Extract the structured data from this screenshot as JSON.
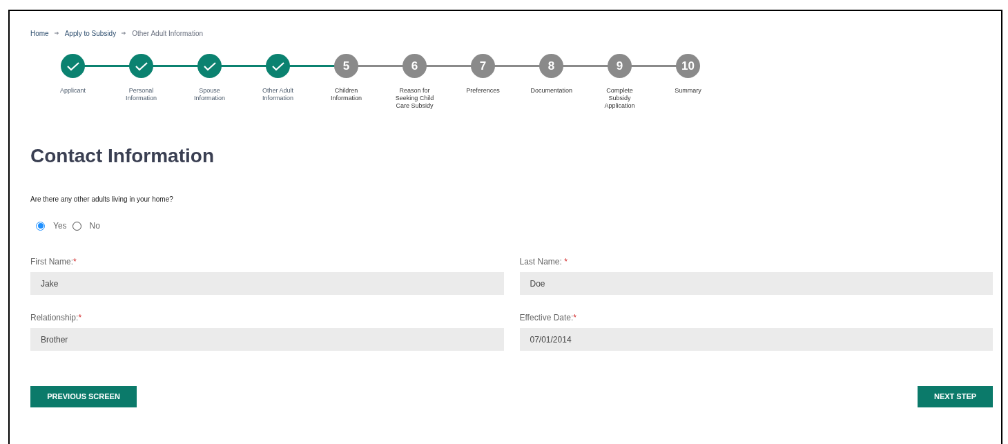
{
  "breadcrumb": [
    {
      "label": "Home",
      "current": false
    },
    {
      "label": "Apply to Subsidy",
      "current": false
    },
    {
      "label": "Other Adult Information",
      "current": true
    }
  ],
  "steps": [
    {
      "label": "Applicant",
      "done": true
    },
    {
      "label": "Personal Information",
      "done": true
    },
    {
      "label": "Spouse Information",
      "done": true
    },
    {
      "label": "Other Adult Information",
      "done": true
    },
    {
      "number": "5",
      "label": "Children Information",
      "done": false
    },
    {
      "number": "6",
      "label": "Reason for Seeking Child Care Subsidy",
      "done": false
    },
    {
      "number": "7",
      "label": "Preferences",
      "done": false
    },
    {
      "number": "8",
      "label": "Documentation",
      "done": false
    },
    {
      "number": "9",
      "label": "Complete Subsidy Application",
      "done": false
    },
    {
      "number": "10",
      "label": "Summary",
      "done": false
    }
  ],
  "heading": "Contact Information",
  "question": "Are there any other adults living in your home?",
  "options": [
    {
      "label": "Yes",
      "selected": true
    },
    {
      "label": "No",
      "selected": false
    }
  ],
  "fields": [
    {
      "label": "First Name:",
      "required_mark": "*",
      "value": "Jake"
    },
    {
      "label": "Last Name: ",
      "required_mark": "*",
      "value": "Doe"
    },
    {
      "label": "Relationship:",
      "required_mark": "*",
      "value": "Brother"
    },
    {
      "label": "Effective Date:",
      "required_mark": "*",
      "value": "07/01/2014"
    }
  ],
  "buttons": {
    "previous": "PREVIOUS SCREEN",
    "next": "NEXT STEP"
  }
}
